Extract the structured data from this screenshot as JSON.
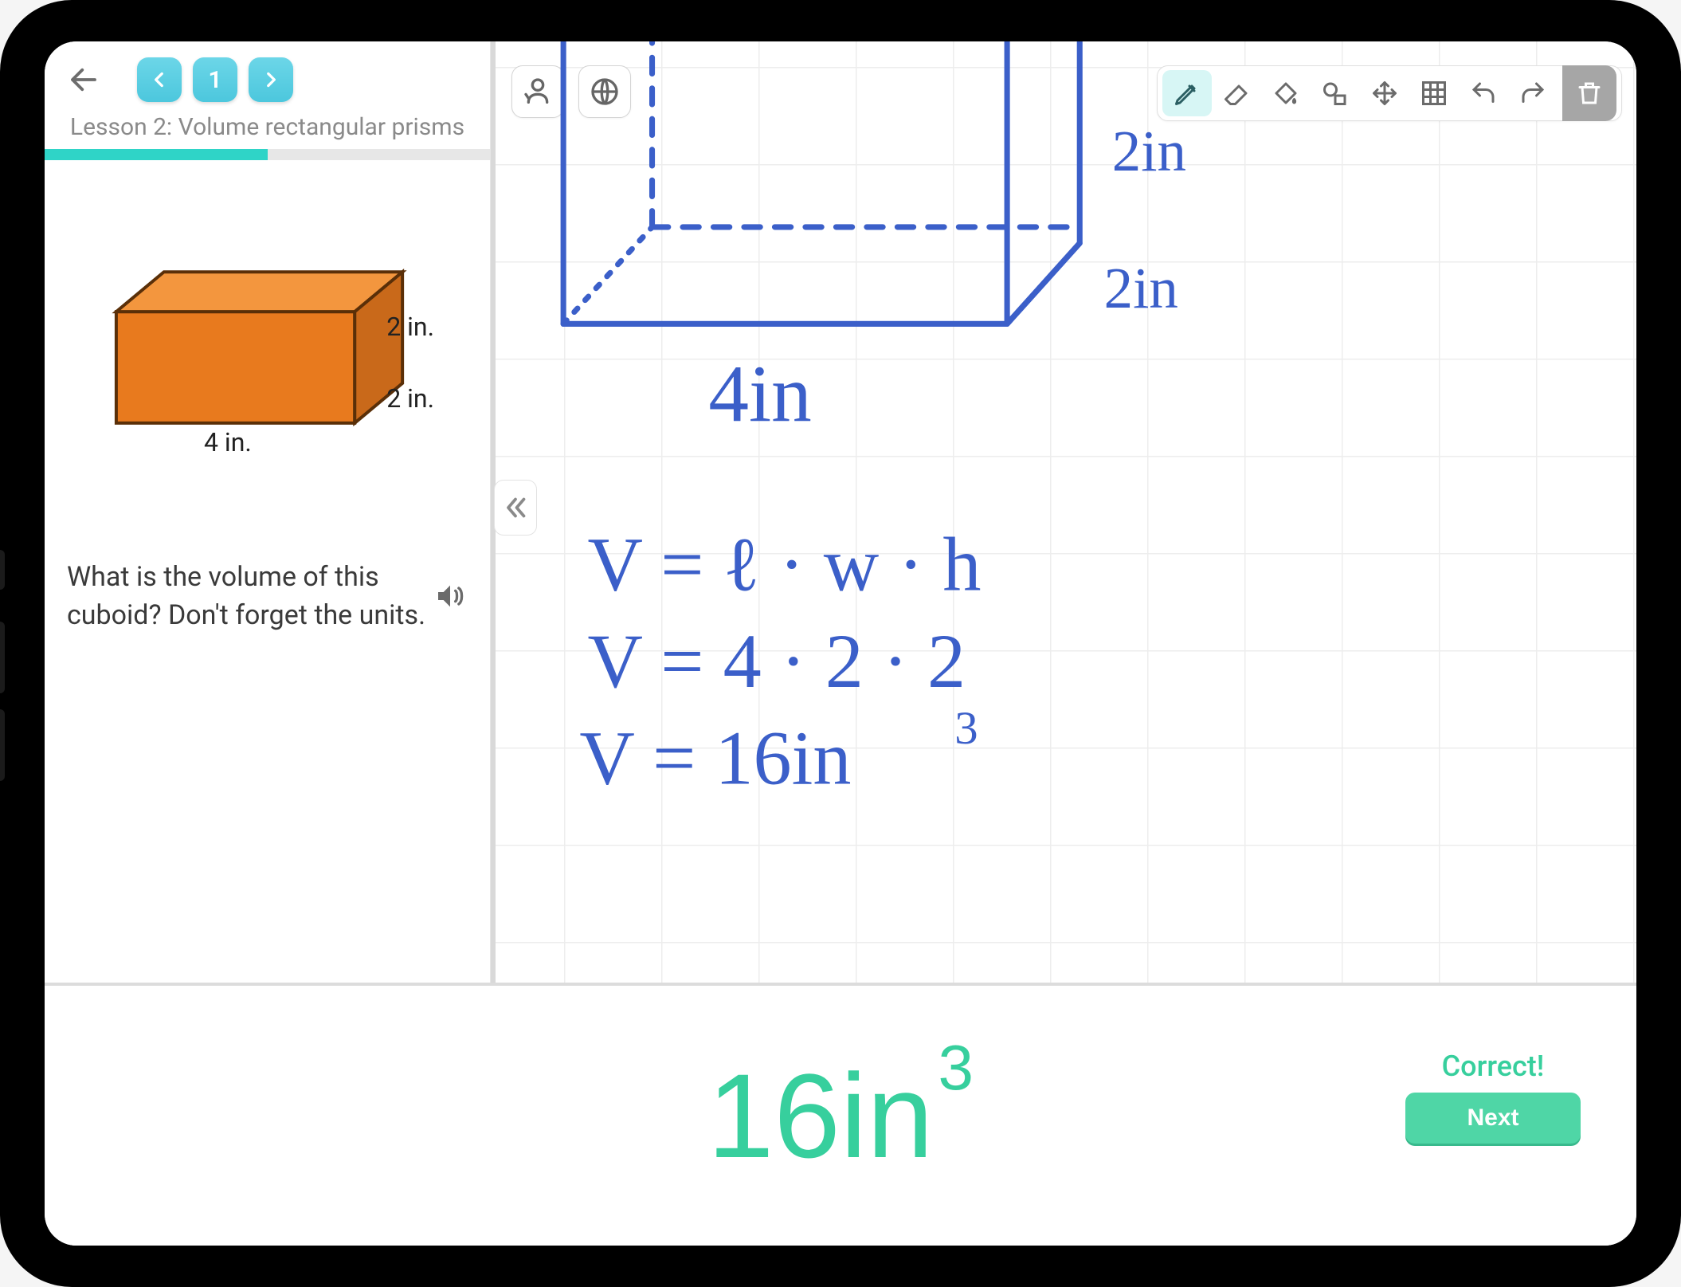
{
  "sidebar": {
    "page_number": "1",
    "lesson_title": "Lesson 2: Volume rectangular prisms",
    "dimensions": {
      "height": "2 in.",
      "depth": "2 in.",
      "length": "4 in."
    },
    "question": "What is the volume of this cuboid? Don't forget the units."
  },
  "canvas": {
    "handwriting": {
      "top_label_1": "2in",
      "top_label_2": "2in",
      "bottom_label": "4in",
      "line1": "V = l · w · h",
      "line2": "V = 4 · 2 · 2",
      "line3": "V = 16in³"
    }
  },
  "answer": {
    "value": "16in",
    "exponent": "3",
    "result_label": "Correct!",
    "next_label": "Next"
  },
  "tools": {
    "pencil": "pencil",
    "eraser": "eraser",
    "fill": "fill",
    "shapes": "shapes",
    "move": "move",
    "grid": "grid",
    "undo": "undo",
    "redo": "redo",
    "trash": "trash"
  }
}
